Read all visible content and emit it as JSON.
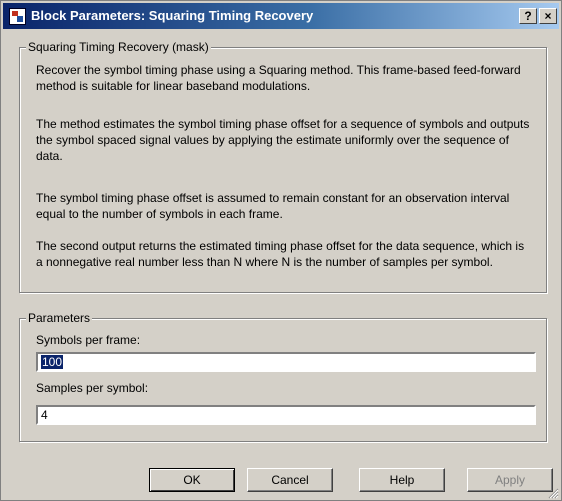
{
  "window": {
    "title": "Block Parameters: Squaring Timing Recovery",
    "help_glyph": "?",
    "close_glyph": "×"
  },
  "description": {
    "legend": "Squaring Timing Recovery (mask)",
    "paragraphs": [
      "Recover the symbol timing phase using a Squaring method. This frame-based feed-forward method is suitable for linear baseband modulations.",
      "The method estimates the symbol timing phase offset for a sequence of symbols and outputs the symbol spaced signal values by applying the estimate uniformly over the sequence of data.",
      "The symbol timing phase offset is assumed to remain constant for an observation interval equal to the number of symbols in each frame.",
      "The second output returns the estimated timing phase offset for the data sequence, which is a nonnegative real number less than N where N is the number of samples per symbol."
    ]
  },
  "parameters": {
    "legend": "Parameters",
    "symbols_per_frame_label": "Symbols per frame:",
    "symbols_per_frame_value": "100",
    "samples_per_symbol_label": "Samples per symbol:",
    "samples_per_symbol_value": "4"
  },
  "buttons": {
    "ok": "OK",
    "cancel": "Cancel",
    "help": "Help",
    "apply": "Apply"
  },
  "colors": {
    "titlebar_start": "#0a246a",
    "titlebar_end": "#a6caf0",
    "dialog_bg": "#d4d0c8"
  }
}
